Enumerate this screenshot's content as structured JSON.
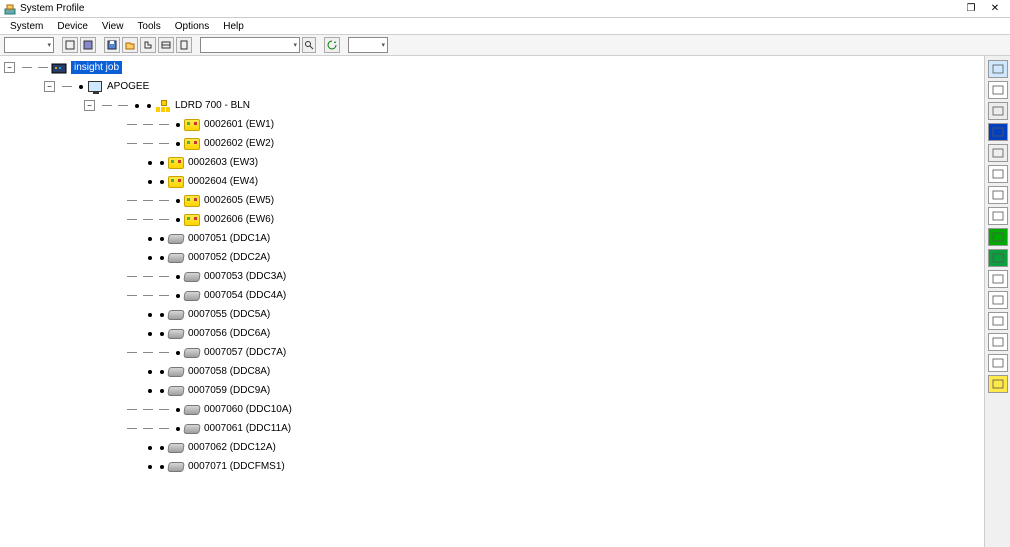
{
  "app": {
    "title": "System Profile"
  },
  "menu": [
    "System",
    "Device",
    "View",
    "Tools",
    "Options",
    "Help"
  ],
  "winbtns": {
    "max": "❐",
    "close": "✕"
  },
  "toolbar": {
    "combo1_width": 50,
    "combo2_width": 100,
    "combo3_width": 40
  },
  "tree": {
    "root": "insight job",
    "level1": "APOGEE",
    "level2": "LDRD 700 - BLN",
    "devices": [
      {
        "id": "0002601",
        "tag": "(EW1)",
        "type": "yellow",
        "leaf": false
      },
      {
        "id": "0002602",
        "tag": "(EW2)",
        "type": "yellow",
        "leaf": false
      },
      {
        "id": "0002603",
        "tag": "(EW3)",
        "type": "yellow",
        "leaf": true
      },
      {
        "id": "0002604",
        "tag": "(EW4)",
        "type": "yellow",
        "leaf": true
      },
      {
        "id": "0002605",
        "tag": "(EW5)",
        "type": "yellow",
        "leaf": false
      },
      {
        "id": "0002606",
        "tag": "(EW6)",
        "type": "yellow",
        "leaf": false
      },
      {
        "id": "0007051",
        "tag": "(DDC1A)",
        "type": "gray",
        "leaf": true
      },
      {
        "id": "0007052",
        "tag": "(DDC2A)",
        "type": "gray",
        "leaf": true
      },
      {
        "id": "0007053",
        "tag": "(DDC3A)",
        "type": "gray",
        "leaf": false
      },
      {
        "id": "0007054",
        "tag": "(DDC4A)",
        "type": "gray",
        "leaf": false
      },
      {
        "id": "0007055",
        "tag": "(DDC5A)",
        "type": "gray",
        "leaf": true
      },
      {
        "id": "0007056",
        "tag": "(DDC6A)",
        "type": "gray",
        "leaf": true
      },
      {
        "id": "0007057",
        "tag": "(DDC7A)",
        "type": "gray",
        "leaf": false
      },
      {
        "id": "0007058",
        "tag": "(DDC8A)",
        "type": "gray",
        "leaf": true
      },
      {
        "id": "0007059",
        "tag": "(DDC9A)",
        "type": "gray",
        "leaf": true
      },
      {
        "id": "0007060",
        "tag": "(DDC10A)",
        "type": "gray",
        "leaf": false
      },
      {
        "id": "0007061",
        "tag": "(DDC11A)",
        "type": "gray",
        "leaf": false
      },
      {
        "id": "0007062",
        "tag": "(DDC12A)",
        "type": "gray",
        "leaf": true
      },
      {
        "id": "0007071",
        "tag": "(DDCFMS1)",
        "type": "gray",
        "leaf": true
      }
    ]
  },
  "dock_count": 16
}
